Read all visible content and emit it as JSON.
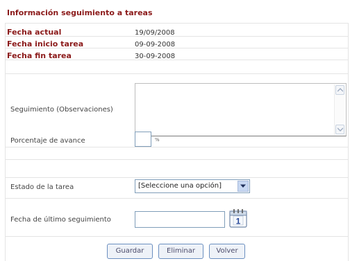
{
  "form": {
    "title": "Información seguimiento a tareas",
    "info_rows": [
      {
        "label": "Fecha actual",
        "value": "19/09/2008"
      },
      {
        "label": "Fecha inicio tarea",
        "value": "09-09-2008"
      },
      {
        "label": "Fecha fin tarea",
        "value": "30-09-2008"
      }
    ],
    "observaciones_label": "Seguimiento (Observaciones)",
    "observaciones_value": "",
    "porcentaje_label": "Porcentaje de avance",
    "porcentaje_value": "",
    "porcentaje_sign": "%",
    "estado_label": "Estado de la tarea",
    "estado_selected": "[Seleccione una opción]",
    "fecha_seguimiento_label": "Fecha de último seguimiento",
    "fecha_seguimiento_value": "",
    "calendar_glyph": "1"
  },
  "buttons": {
    "guardar": "Guardar",
    "eliminar": "Eliminar",
    "volver": "Volver"
  },
  "colors": {
    "label_accent": "#8b1a1a",
    "input_border": "#7f9db9",
    "button_border": "#6b8fc0"
  },
  "icons": [
    "scroll-up-icon",
    "scroll-down-icon",
    "dropdown-arrow-icon",
    "calendar-icon"
  ]
}
